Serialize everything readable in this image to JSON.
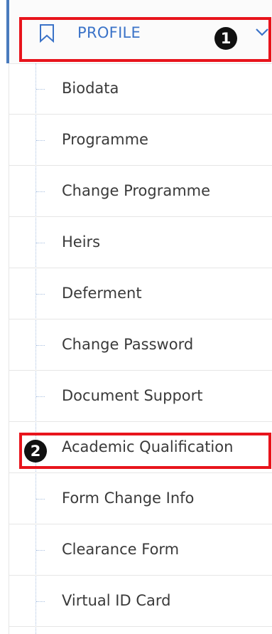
{
  "header": {
    "label": "PROFILE",
    "icon": "bookmark-icon",
    "expand_icon": "chevron-down-icon",
    "accent_color": "#3b73c8"
  },
  "callouts": {
    "first": "1",
    "second": "2"
  },
  "highlight_color": "#e8141c",
  "menu": {
    "items": [
      {
        "label": "Biodata"
      },
      {
        "label": "Programme"
      },
      {
        "label": "Change Programme"
      },
      {
        "label": "Heirs"
      },
      {
        "label": "Deferment"
      },
      {
        "label": "Change Password"
      },
      {
        "label": "Document Support"
      },
      {
        "label": "Academic Qualification"
      },
      {
        "label": "Form Change Info"
      },
      {
        "label": "Clearance Form"
      },
      {
        "label": "Virtual ID Card"
      }
    ]
  }
}
